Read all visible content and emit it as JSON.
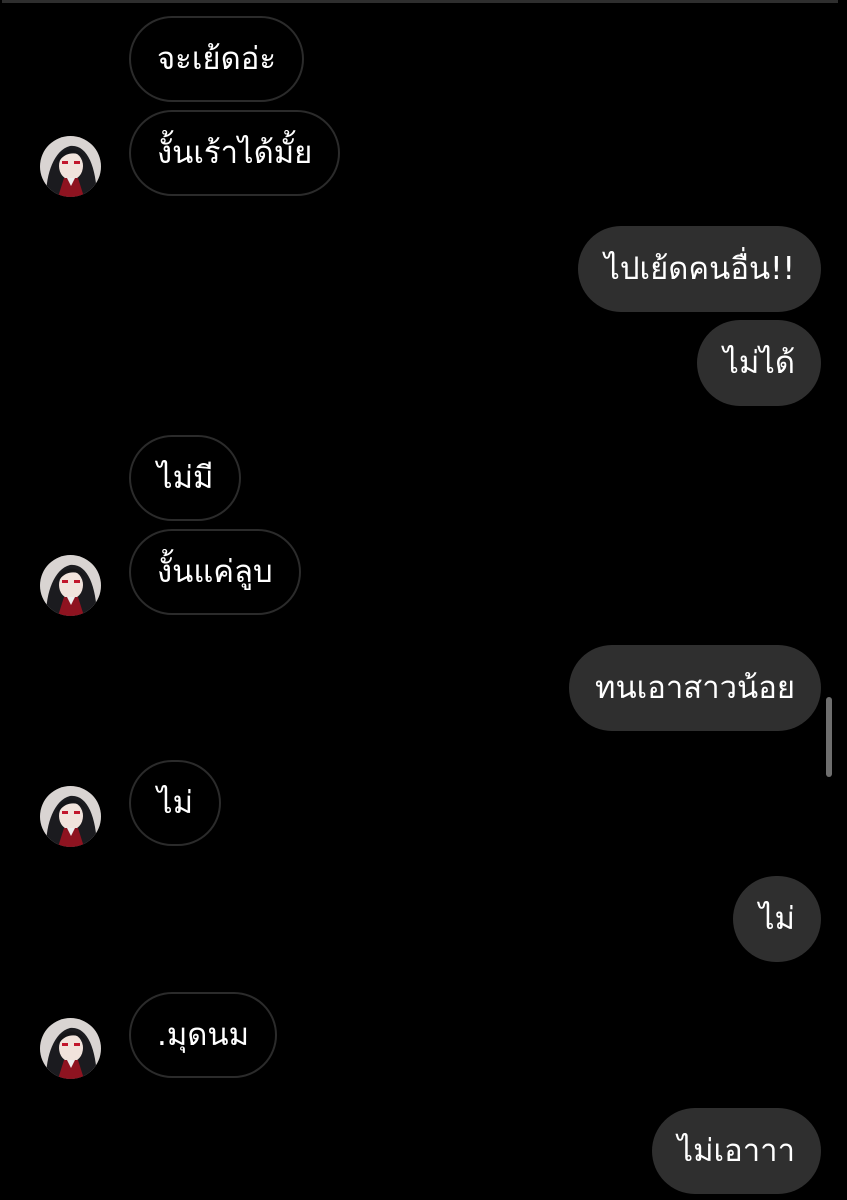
{
  "chat": {
    "messages": [
      {
        "side": "incoming",
        "text": "จะเย้ดอ่ะ"
      },
      {
        "side": "incoming",
        "text": "งั้นเร้าได้มั้ย"
      },
      {
        "side": "outgoing",
        "text": "ไปเย้ดคนอื่น!!"
      },
      {
        "side": "outgoing",
        "text": "ไม่ได้"
      },
      {
        "side": "incoming",
        "text": "ไม่มี"
      },
      {
        "side": "incoming",
        "text": "งั้นแค่ลูบ"
      },
      {
        "side": "outgoing",
        "text": "ทนเอาสาวน้อย"
      },
      {
        "side": "incoming",
        "text": "ไม่"
      },
      {
        "side": "outgoing",
        "text": "ไม่"
      },
      {
        "side": "incoming",
        "text": ".มุดนม"
      },
      {
        "side": "outgoing",
        "text": "ไม่เอาาา"
      }
    ]
  },
  "colors": {
    "background": "#000000",
    "outgoing_bubble": "#2f2f2f",
    "incoming_border": "#2b2b2b",
    "text": "#ffffff"
  },
  "icons": {
    "avatar": "anime-character-avatar-icon"
  }
}
